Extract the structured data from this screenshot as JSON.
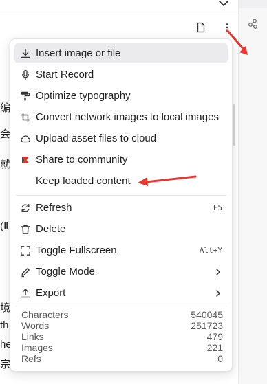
{
  "background": {
    "fragments": [
      "编",
      "会",
      "就",
      "(Ⅱ",
      "境",
      "th",
      "he",
      "宗兴"
    ]
  },
  "menu": {
    "items": [
      {
        "label": "Insert image or file",
        "icon": "download-icon"
      },
      {
        "label": "Start Record",
        "icon": "microphone-icon"
      },
      {
        "label": "Optimize typography",
        "icon": "paint-roller-icon"
      },
      {
        "label": "Convert network images to local images",
        "icon": "crop-icon"
      },
      {
        "label": "Upload asset files to cloud",
        "icon": "cloud-icon"
      },
      {
        "label": "Share to community",
        "icon": "share-community-icon"
      },
      {
        "label": "Keep loaded content",
        "icon": ""
      },
      {
        "label": "Refresh",
        "icon": "refresh-icon",
        "shortcut": "F5"
      },
      {
        "label": "Delete",
        "icon": "trash-icon"
      },
      {
        "label": "Toggle Fullscreen",
        "icon": "fullscreen-icon",
        "shortcut": "Alt+Y"
      },
      {
        "label": "Toggle Mode",
        "icon": "pencil-icon"
      },
      {
        "label": "Export",
        "icon": "export-icon"
      }
    ],
    "stats": [
      {
        "label": "Characters",
        "value": "540045"
      },
      {
        "label": "Words",
        "value": "251723"
      },
      {
        "label": "Links",
        "value": "479"
      },
      {
        "label": "Images",
        "value": "221"
      },
      {
        "label": "Refs",
        "value": "0"
      }
    ]
  },
  "colors": {
    "annotation_arrow": "#e8372f",
    "share_icon": "#d9342b",
    "hover_bg": "#ebebed"
  }
}
